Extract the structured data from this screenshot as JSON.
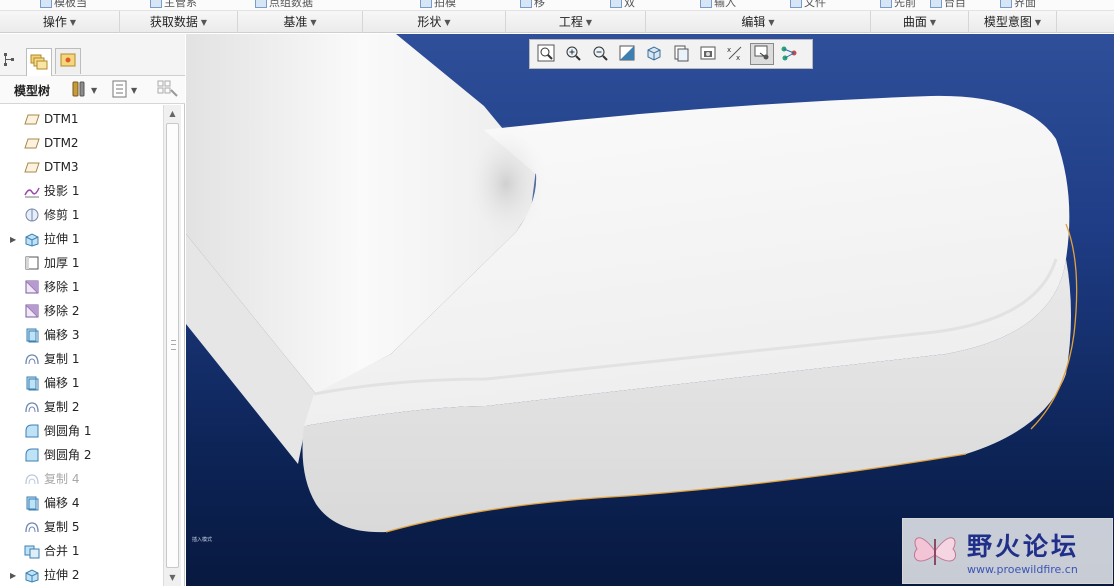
{
  "ribbon": {
    "top_fragments": [
      "模板当",
      "主管系",
      "点组数据",
      "拍模",
      "移",
      "双",
      "输入",
      "文件",
      "先前",
      "台目",
      "界面"
    ],
    "groups": [
      {
        "label": "操作"
      },
      {
        "label": "获取数据"
      },
      {
        "label": "基准"
      },
      {
        "label": "形状"
      },
      {
        "label": "工程"
      },
      {
        "label": "编辑"
      },
      {
        "label": "曲面"
      },
      {
        "label": "模型意图"
      }
    ]
  },
  "model_tree": {
    "title": "模型树",
    "items": [
      {
        "label": "DTM1",
        "icon": "datum-plane-icon",
        "expandable": false,
        "suppressed": false
      },
      {
        "label": "DTM2",
        "icon": "datum-plane-icon",
        "expandable": false,
        "suppressed": false
      },
      {
        "label": "DTM3",
        "icon": "datum-plane-icon",
        "expandable": false,
        "suppressed": false
      },
      {
        "label": "投影 1",
        "icon": "projection-icon",
        "expandable": false,
        "suppressed": false
      },
      {
        "label": "修剪 1",
        "icon": "trim-icon",
        "expandable": false,
        "suppressed": false
      },
      {
        "label": "拉伸 1",
        "icon": "extrude-icon",
        "expandable": true,
        "suppressed": false
      },
      {
        "label": "加厚 1",
        "icon": "thicken-icon",
        "expandable": false,
        "suppressed": false
      },
      {
        "label": "移除 1",
        "icon": "remove-icon",
        "expandable": false,
        "suppressed": false
      },
      {
        "label": "移除 2",
        "icon": "remove-icon",
        "expandable": false,
        "suppressed": false
      },
      {
        "label": "偏移 3",
        "icon": "offset-icon",
        "expandable": false,
        "suppressed": false
      },
      {
        "label": "复制 1",
        "icon": "copy-icon",
        "expandable": false,
        "suppressed": false
      },
      {
        "label": "偏移 1",
        "icon": "offset-icon",
        "expandable": false,
        "suppressed": false
      },
      {
        "label": "复制 2",
        "icon": "copy-icon",
        "expandable": false,
        "suppressed": false
      },
      {
        "label": "倒圆角 1",
        "icon": "round-icon",
        "expandable": false,
        "suppressed": false
      },
      {
        "label": "倒圆角 2",
        "icon": "round-icon",
        "expandable": false,
        "suppressed": false
      },
      {
        "label": "复制 4",
        "icon": "copy-icon",
        "expandable": false,
        "suppressed": true
      },
      {
        "label": "偏移 4",
        "icon": "offset-icon",
        "expandable": false,
        "suppressed": false
      },
      {
        "label": "复制 5",
        "icon": "copy-icon",
        "expandable": false,
        "suppressed": false
      },
      {
        "label": "合并 1",
        "icon": "merge-icon",
        "expandable": false,
        "suppressed": false
      },
      {
        "label": "拉伸 2",
        "icon": "extrude-icon",
        "expandable": true,
        "suppressed": false
      }
    ]
  },
  "view_toolbar": {
    "buttons": [
      {
        "name": "refit-icon"
      },
      {
        "name": "zoom-in-icon"
      },
      {
        "name": "zoom-out-icon"
      },
      {
        "name": "repaint-icon"
      },
      {
        "name": "display-style-icon"
      },
      {
        "name": "saved-views-icon"
      },
      {
        "name": "view-manager-icon"
      },
      {
        "name": "datum-display-icon"
      },
      {
        "name": "spin-center-icon"
      },
      {
        "name": "annotation-display-icon"
      }
    ]
  },
  "viewport": {
    "mode_text": "插入模式"
  },
  "watermark": {
    "title": "野火论坛",
    "url": "www.proewildfire.cn"
  },
  "colors": {
    "viewport_top": "#2f4f9a",
    "viewport_bottom": "#08193f",
    "model_surface": "#f4f4f4",
    "edge_highlight": "#e3a13b"
  }
}
